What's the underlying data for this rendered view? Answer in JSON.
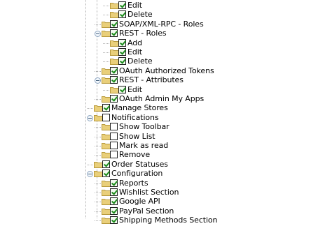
{
  "tree": {
    "nodes": [
      {
        "label": "Edit",
        "level": 3,
        "checked": true
      },
      {
        "label": "Delete",
        "level": 3,
        "checked": true
      },
      {
        "label": "SOAP/XML-RPC - Roles",
        "level": 2,
        "checked": true
      },
      {
        "label": "REST - Roles",
        "level": 2,
        "checked": true,
        "expanded": true
      },
      {
        "label": "Add",
        "level": 3,
        "checked": true
      },
      {
        "label": "Edit",
        "level": 3,
        "checked": true
      },
      {
        "label": "Delete",
        "level": 3,
        "checked": true
      },
      {
        "label": "OAuth Authorized Tokens",
        "level": 2,
        "checked": true
      },
      {
        "label": "REST - Attributes",
        "level": 2,
        "checked": true,
        "expanded": true
      },
      {
        "label": "Edit",
        "level": 3,
        "checked": true
      },
      {
        "label": "OAuth Admin My Apps",
        "level": 2,
        "checked": true
      },
      {
        "label": "Manage Stores",
        "level": 1,
        "checked": true
      },
      {
        "label": "Notifications",
        "level": 1,
        "checked": false,
        "expanded": true
      },
      {
        "label": "Show Toolbar",
        "level": 2,
        "checked": false
      },
      {
        "label": "Show List",
        "level": 2,
        "checked": false
      },
      {
        "label": "Mark as read",
        "level": 2,
        "checked": false
      },
      {
        "label": "Remove",
        "level": 2,
        "checked": false
      },
      {
        "label": "Order Statuses",
        "level": 1,
        "checked": true
      },
      {
        "label": "Configuration",
        "level": 1,
        "checked": true,
        "expanded": true
      },
      {
        "label": "Reports",
        "level": 2,
        "checked": true
      },
      {
        "label": "Wishlist Section",
        "level": 2,
        "checked": true
      },
      {
        "label": "Google API",
        "level": 2,
        "checked": true
      },
      {
        "label": "PayPal Section",
        "level": 2,
        "checked": true
      },
      {
        "label": "Shipping Methods Section",
        "level": 2,
        "checked": true
      }
    ]
  },
  "colors": {
    "checkmark": "#1a8a1a",
    "folder": "#e9cf7a",
    "connector": "#b0b0b0"
  },
  "icons": {
    "folder": "folder-icon",
    "toggle": "collapse-toggle-icon",
    "checkbox": "checkbox-icon"
  }
}
